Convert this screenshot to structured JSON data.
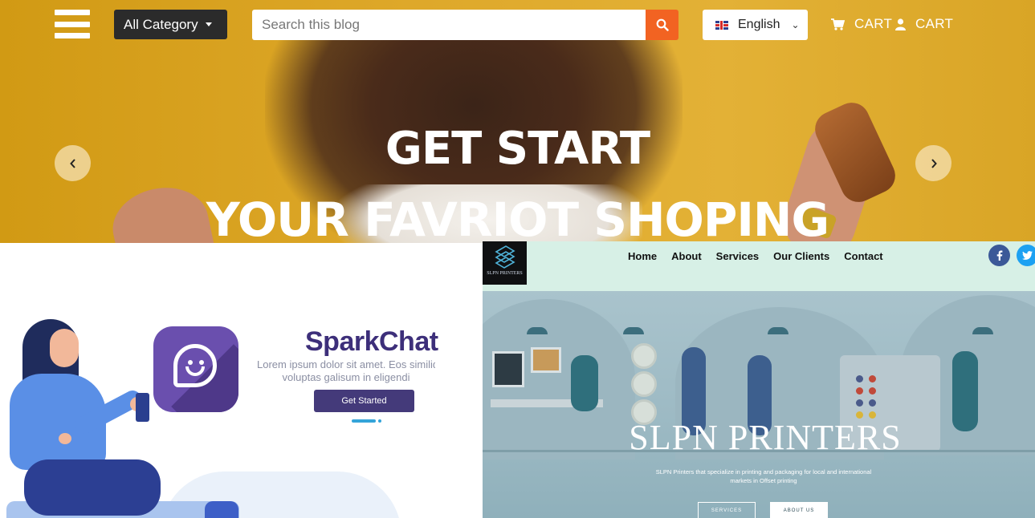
{
  "hero": {
    "category_label": "All Category",
    "search_placeholder": "Search this blog",
    "language_label": "English",
    "cart_label_1": "CART",
    "cart_label_2": "CART",
    "headline_1": "GET START",
    "headline_2": "YOUR FAVRIOT SHOPING",
    "colors": {
      "search_button": "#f26322",
      "category_bg": "#2b2b2b",
      "banner": "#dea82a"
    }
  },
  "sparkchat": {
    "title": "SparkChat",
    "body_line_1": "Lorem ipsum dolor sit amet. Eos similiqu",
    "body_line_2": "voluptas galisum in eligendi",
    "button_label": "Get Started",
    "colors": {
      "title": "#3d2f7a",
      "button": "#443a7a",
      "icon": "#6a4fae"
    }
  },
  "slpn": {
    "logo_text": "SLPN PRINTERS",
    "nav": [
      "Home",
      "About",
      "Services",
      "Our Clients",
      "Contact"
    ],
    "title": "SLPN PRINTERS",
    "subtitle_line_1": "SLPN Printers that specialize in printing and packaging for local and international",
    "subtitle_line_2": "markets in Offset printing",
    "button_services": "SERVICES",
    "button_about": "ABOUT US",
    "colors": {
      "nav_bg": "#d7f0e6",
      "facebook": "#3b5998",
      "twitter": "#1da1f2"
    }
  }
}
